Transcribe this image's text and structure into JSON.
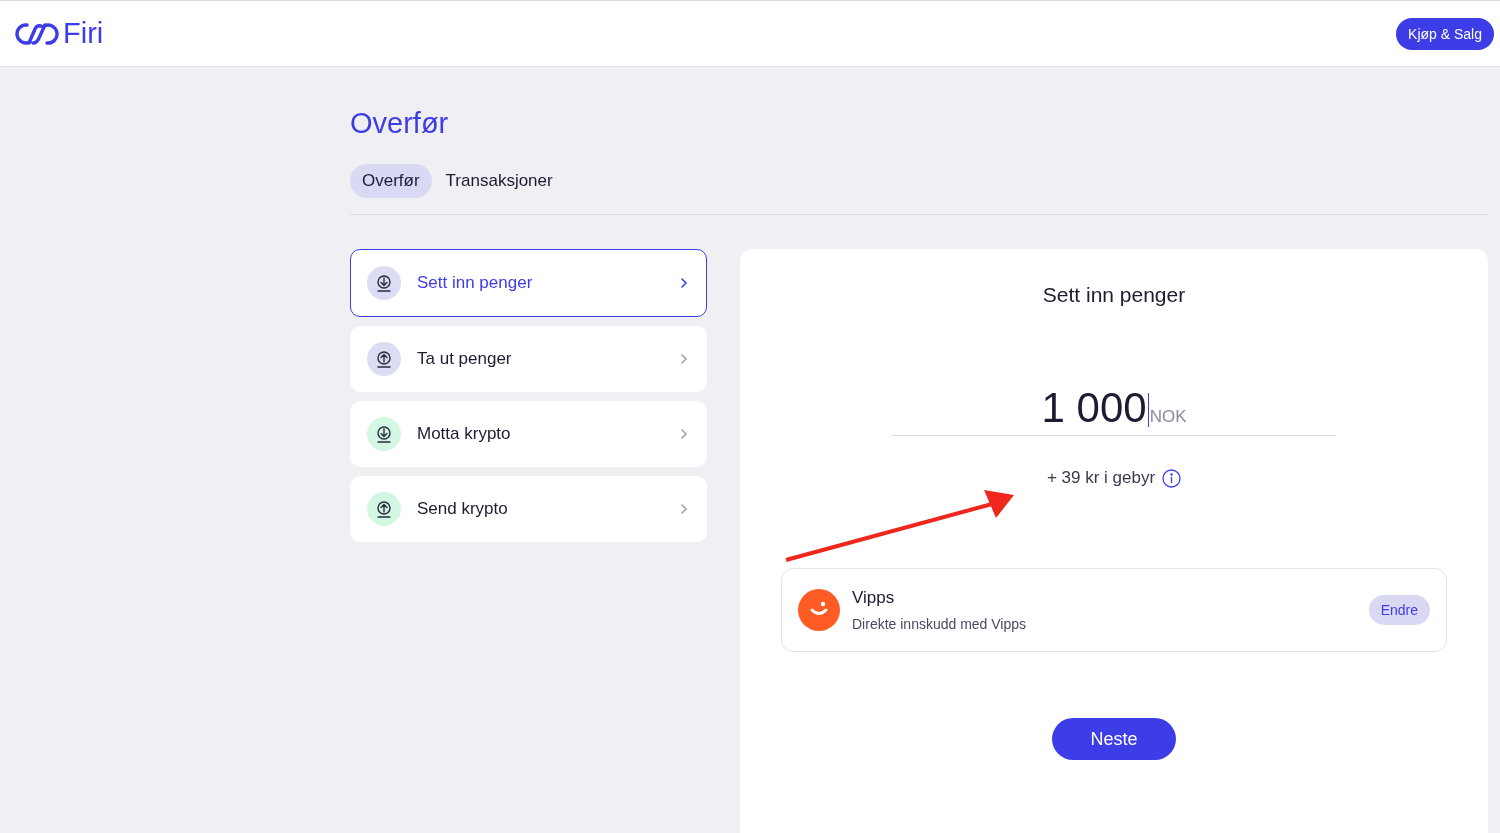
{
  "header": {
    "logo_text": "Firi",
    "action_button": "Kjøp & Salg"
  },
  "page": {
    "title": "Overfør"
  },
  "tabs": [
    {
      "label": "Overfør",
      "selected": true
    },
    {
      "label": "Transaksjoner",
      "selected": false
    }
  ],
  "menu": [
    {
      "label": "Sett inn penger",
      "kind": "download",
      "color": "#dcdcf5",
      "selected": true
    },
    {
      "label": "Ta ut penger",
      "kind": "upload",
      "color": "#dcdcf5",
      "selected": false
    },
    {
      "label": "Motta krypto",
      "kind": "download",
      "color": "#d4f7e4",
      "selected": false
    },
    {
      "label": "Send krypto",
      "kind": "upload",
      "color": "#d4f7e4",
      "selected": false
    }
  ],
  "panel": {
    "title": "Sett inn penger",
    "amount": "1 000",
    "currency": "NOK",
    "fee": "+ 39 kr i gebyr",
    "method": {
      "name": "Vipps",
      "description": "Direkte innskudd med Vipps",
      "change_button": "Endre"
    },
    "next_button": "Neste"
  }
}
